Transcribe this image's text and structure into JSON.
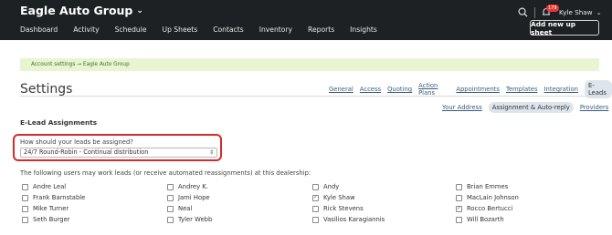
{
  "header": {
    "brand": "Eagle Auto Group",
    "nav": [
      "Dashboard",
      "Activity",
      "Schedule",
      "Up Sheets",
      "Contacts",
      "Inventory",
      "Reports",
      "Insights"
    ],
    "notification_count": "179",
    "user_name": "Kyle Shaw",
    "new_up_sheet_label": "Add new up sheet"
  },
  "breadcrumb": "Account settings → Eagle Auto Group",
  "page_title": "Settings",
  "settings_tabs": [
    {
      "label": "General",
      "active": false
    },
    {
      "label": "Access",
      "active": false
    },
    {
      "label": "Quoting",
      "active": false
    },
    {
      "label": "Action Plans",
      "active": false
    },
    {
      "label": "Appointments",
      "active": false
    },
    {
      "label": "Templates",
      "active": false
    },
    {
      "label": "Integration",
      "active": false
    },
    {
      "label": "E-Leads",
      "active": true
    }
  ],
  "sub_tabs": [
    {
      "label": "Your Address",
      "active": false
    },
    {
      "label": "Assignment & Auto-reply",
      "active": true
    },
    {
      "label": "Providers",
      "active": false
    }
  ],
  "section_title": "E-Lead Assignments",
  "assignment": {
    "question": "How should your leads be assigned?",
    "selected": "24/7 Round-Robin - Continual distribution"
  },
  "users_intro": "The following users may work leads (or receive automated reassignments) at this dealership:",
  "users": [
    [
      {
        "name": "Andre Leal",
        "checked": false
      },
      {
        "name": "Frank Barnstable",
        "checked": false
      },
      {
        "name": "Mike Turner",
        "checked": false
      },
      {
        "name": "Seth Burger",
        "checked": false
      }
    ],
    [
      {
        "name": "Andrey K.",
        "checked": false
      },
      {
        "name": "Jami Hope",
        "checked": false
      },
      {
        "name": "Neal",
        "checked": false
      },
      {
        "name": "Tyler Webb",
        "checked": false
      }
    ],
    [
      {
        "name": "Andy",
        "checked": false
      },
      {
        "name": "Kyle Shaw",
        "checked": true
      },
      {
        "name": "Rick Stevens",
        "checked": false
      },
      {
        "name": "Vasilios Karagiannis",
        "checked": false
      }
    ],
    [
      {
        "name": "Brian Emmes",
        "checked": false
      },
      {
        "name": "MacLain Johnson",
        "checked": false
      },
      {
        "name": "Rocco Bertucci",
        "checked": true
      },
      {
        "name": "Will Bozarth",
        "checked": false
      }
    ]
  ]
}
